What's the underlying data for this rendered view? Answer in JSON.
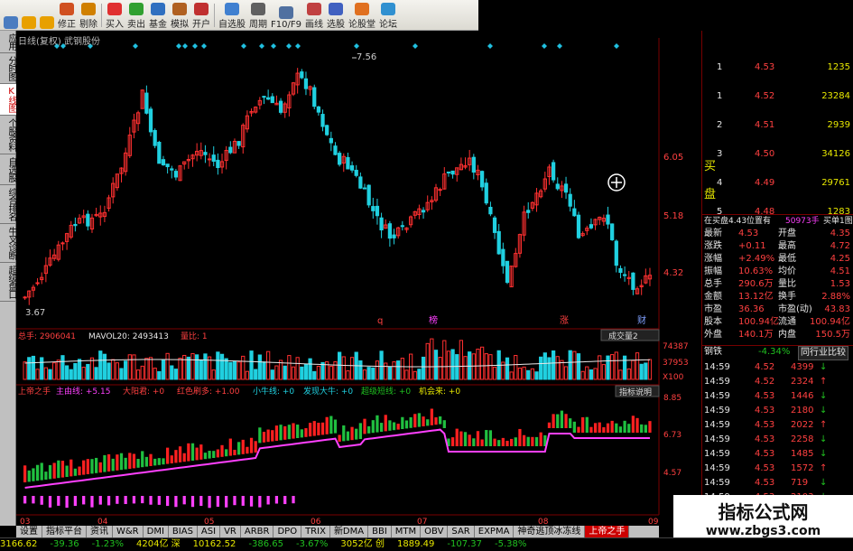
{
  "toolbar": {
    "buttons": [
      "修正",
      "剔除",
      "买入",
      "卖出",
      "基金",
      "模拟",
      "开户",
      "自选股",
      "周期",
      "F10/F9",
      "画线",
      "选股",
      "论股堂",
      "论坛"
    ]
  },
  "side_tabs": [
    "应用",
    "分时图",
    "K线图",
    "个股资料",
    "自选股",
    "综合排名",
    "牛叉诊断",
    "超级盘口"
  ],
  "chart": {
    "title": "日线(复权) 武钢股份",
    "high_label": "7.56",
    "low_label": "3.67",
    "price_axis": [
      "6.05",
      "5.18",
      "4.32"
    ],
    "markers": [
      "q",
      "榜",
      "涨",
      "财"
    ],
    "volume_label": "总手: 2906041",
    "mavol_label": "MAVOL20: 2493413",
    "ratio_label": "量比: 1",
    "volume_axis": [
      "74387",
      "37953",
      "X100"
    ],
    "volume_dropdown": "成交量2",
    "indicator_title": "上帝之手",
    "indicator_items": [
      "主由线: +5.15",
      "大阳君: +0",
      "红色刷多: +1.00",
      "小牛线: +0",
      "发现大牛: +0",
      "超级短线: +0",
      "机会来: +0"
    ],
    "indicator_help": "指标说明",
    "indicator_axis": [
      "8.85",
      "6.73",
      "4.57"
    ],
    "date_axis": [
      "03",
      "04",
      "05",
      "06",
      "07",
      "08",
      "09"
    ]
  },
  "bottom_tabs": [
    "设置",
    "指标平台",
    "资讯",
    "W&R",
    "DMI",
    "BIAS",
    "ASI",
    "VR",
    "ARBR",
    "DPO",
    "TRIX",
    "新DMA",
    "BBI",
    "MTM",
    "OBV",
    "SAR",
    "EXPMA",
    "神奇逃顶冰冻线",
    "上帝之手"
  ],
  "order_book": {
    "sell": [
      {
        "level": "5",
        "price": "4.48",
        "vol": "1283"
      },
      {
        "level": "4",
        "price": "4.49",
        "vol": "29761"
      },
      {
        "level": "3",
        "price": "4.50",
        "vol": "34126"
      },
      {
        "level": "2",
        "price": "4.51",
        "vol": "2939"
      },
      {
        "level": "1",
        "price": "4.52",
        "vol": "23284"
      },
      {
        "level": "1",
        "price": "4.53",
        "vol": "1235"
      }
    ],
    "side_label_buy": "买",
    "side_label_disk": "盘",
    "info": "在买盘4.43位置有",
    "info_vol": "50973手",
    "info_tag": "买单1图"
  },
  "quote": [
    {
      "k1": "最新",
      "v1": "4.53",
      "k2": "开盘",
      "v2": "4.35"
    },
    {
      "k1": "涨跌",
      "v1": "+0.11",
      "k2": "最高",
      "v2": "4.72"
    },
    {
      "k1": "涨幅",
      "v1": "+2.49%",
      "k2": "最低",
      "v2": "4.25"
    },
    {
      "k1": "振幅",
      "v1": "10.63%",
      "k2": "均价",
      "v2": "4.51"
    },
    {
      "k1": "总手",
      "v1": "290.6万",
      "k2": "量比",
      "v2": "1.53"
    },
    {
      "k1": "金额",
      "v1": "13.12亿",
      "k2": "换手",
      "v2": "2.88%"
    },
    {
      "k1": "市盈",
      "v1": "36.36",
      "k2": "市盈(动)",
      "v2": "43.83"
    },
    {
      "k1": "股本",
      "v1": "100.94亿",
      "k2": "流通",
      "v2": "100.94亿"
    },
    {
      "k1": "外盘",
      "v1": "140.1万",
      "k2": "内盘",
      "v2": "150.5万"
    }
  ],
  "industry": {
    "name": "钢铁",
    "change": "-4.34%",
    "button": "同行业比较"
  },
  "ticks": [
    {
      "t": "14:59",
      "p": "4.52",
      "v": "4399"
    },
    {
      "t": "14:59",
      "p": "4.52",
      "v": "2324"
    },
    {
      "t": "14:59",
      "p": "4.53",
      "v": "1446"
    },
    {
      "t": "14:59",
      "p": "4.53",
      "v": "2180"
    },
    {
      "t": "14:59",
      "p": "4.53",
      "v": "2022"
    },
    {
      "t": "14:59",
      "p": "4.53",
      "v": "2258"
    },
    {
      "t": "14:59",
      "p": "4.53",
      "v": "1485"
    },
    {
      "t": "14:59",
      "p": "4.53",
      "v": "1572"
    },
    {
      "t": "14:59",
      "p": "4.53",
      "v": "719"
    },
    {
      "t": "14:59",
      "p": "4.53",
      "v": "2103"
    }
  ],
  "status_bar": [
    "3166.62",
    "-39.36",
    "-1.23%",
    "4204亿 深",
    "10162.52",
    "-386.65",
    "-3.67%",
    "3052亿 创",
    "1889.49",
    "-107.37",
    "-5.38%"
  ],
  "watermark": {
    "line1": "指标公式网",
    "line2": "www.zbgs3.com"
  },
  "colors": {
    "up": "#ff3030",
    "down": "#20d0e0",
    "bg": "#000000",
    "axis": "#7a0000"
  }
}
